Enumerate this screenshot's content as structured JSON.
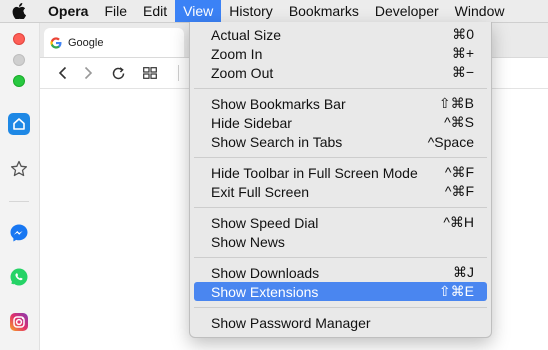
{
  "menubar": {
    "app": "Opera",
    "items": [
      "File",
      "Edit",
      "View",
      "History",
      "Bookmarks",
      "Developer",
      "Window"
    ]
  },
  "tab": {
    "title": "Google"
  },
  "view_menu": {
    "groups": [
      [
        {
          "label": "Actual Size",
          "shortcut": "⌘0"
        },
        {
          "label": "Zoom In",
          "shortcut": "⌘+"
        },
        {
          "label": "Zoom Out",
          "shortcut": "⌘−"
        }
      ],
      [
        {
          "label": "Show Bookmarks Bar",
          "shortcut": "⇧⌘B"
        },
        {
          "label": "Hide Sidebar",
          "shortcut": "^⌘S"
        },
        {
          "label": "Show Search in Tabs",
          "shortcut": "^Space"
        }
      ],
      [
        {
          "label": "Hide Toolbar in Full Screen Mode",
          "shortcut": "^⌘F"
        },
        {
          "label": "Exit Full Screen",
          "shortcut": "^⌘F"
        }
      ],
      [
        {
          "label": "Show Speed Dial",
          "shortcut": "^⌘H"
        },
        {
          "label": "Show News",
          "shortcut": ""
        }
      ],
      [
        {
          "label": "Show Downloads",
          "shortcut": "⌘J"
        },
        {
          "label": "Show Extensions",
          "shortcut": "⇧⌘E"
        }
      ],
      [
        {
          "label": "Show Password Manager",
          "shortcut": ""
        }
      ]
    ],
    "selected": "Show Extensions"
  },
  "colors": {
    "highlight": "#4a86f0",
    "menubar_active": "#3b82f6",
    "messenger": "#1877f2",
    "whatsapp": "#25d366",
    "instagram": "#e1306c",
    "opera_blue": "#1e88e5"
  },
  "icons": {
    "sidebar": [
      "home-icon",
      "bookmarks-star-icon",
      "messenger-icon",
      "whatsapp-icon",
      "instagram-icon"
    ],
    "toolbar": [
      "back-arrow-icon",
      "forward-arrow-icon",
      "reload-icon",
      "tabs-grid-icon"
    ]
  }
}
